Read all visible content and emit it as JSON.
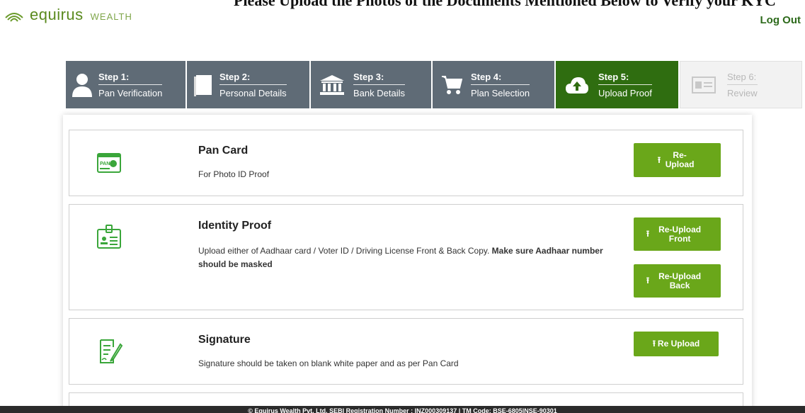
{
  "brand": {
    "name": "equirus",
    "sub": "WEALTH"
  },
  "headline": "Please Upload the Photos of the Documents Mentioned Below to Verify your KYC",
  "header": {
    "logout_label": "Log Out"
  },
  "steps": [
    {
      "num": "Step 1:",
      "name": "Pan Verification",
      "icon": "user-icon",
      "state": "done"
    },
    {
      "num": "Step 2:",
      "name": "Personal Details",
      "icon": "book-icon",
      "state": "done"
    },
    {
      "num": "Step 3:",
      "name": "Bank Details",
      "icon": "bank-icon",
      "state": "done"
    },
    {
      "num": "Step 4:",
      "name": "Plan Selection",
      "icon": "cart-icon",
      "state": "done"
    },
    {
      "num": "Step 5:",
      "name": "Upload Proof",
      "icon": "cloud-upload-icon",
      "state": "active"
    },
    {
      "num": "Step 6:",
      "name": "Review",
      "icon": "id-card-icon",
      "state": "disabled"
    }
  ],
  "cards": {
    "pan": {
      "title": "Pan Card",
      "desc": "For Photo ID Proof",
      "button": "Re-Upload",
      "icon": "pan-card-icon"
    },
    "identity": {
      "title": "Identity Proof",
      "desc": "Upload either of Aadhaar card / Voter ID / Driving License Front & Back Copy.",
      "desc_bold": "Make sure Aadhaar number should be masked",
      "button_front": "Re-Upload Front",
      "button_back": "Re-Upload Back",
      "icon": "id-badge-icon"
    },
    "signature": {
      "title": "Signature",
      "desc": "Signature should be taken on blank white paper and as per Pan Card",
      "button": "Re Upload",
      "icon": "signature-icon"
    }
  },
  "footer": {
    "text": "© Equirus Wealth Pvt. Ltd. SEBI Registration Number : INZ000309137 | TM Code: BSE-6805|NSE-90301"
  },
  "colors": {
    "step_bg": "#5f6b76",
    "step_active": "#2f6d10",
    "button": "#6aa71a",
    "brand": "#5a8a1e"
  }
}
